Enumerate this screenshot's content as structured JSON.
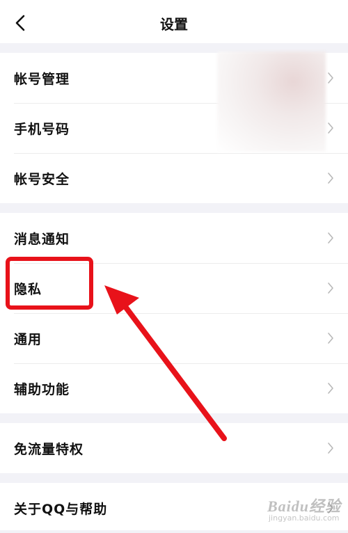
{
  "header": {
    "title": "设置"
  },
  "groups": [
    {
      "items": [
        {
          "label": "帐号管理"
        },
        {
          "label": "手机号码"
        },
        {
          "label": "帐号安全"
        }
      ]
    },
    {
      "items": [
        {
          "label": "消息通知"
        },
        {
          "label": "隐私"
        },
        {
          "label": "通用"
        },
        {
          "label": "辅助功能"
        }
      ]
    },
    {
      "items": [
        {
          "label": "免流量特权"
        }
      ]
    },
    {
      "items": [
        {
          "label": "关于QQ与帮助"
        }
      ]
    }
  ],
  "annotation": {
    "highlight_color": "#e8121a",
    "arrow_color": "#e8121a"
  },
  "watermark": {
    "main": "Baidu经验",
    "sub": "jingyan.baidu.com"
  }
}
